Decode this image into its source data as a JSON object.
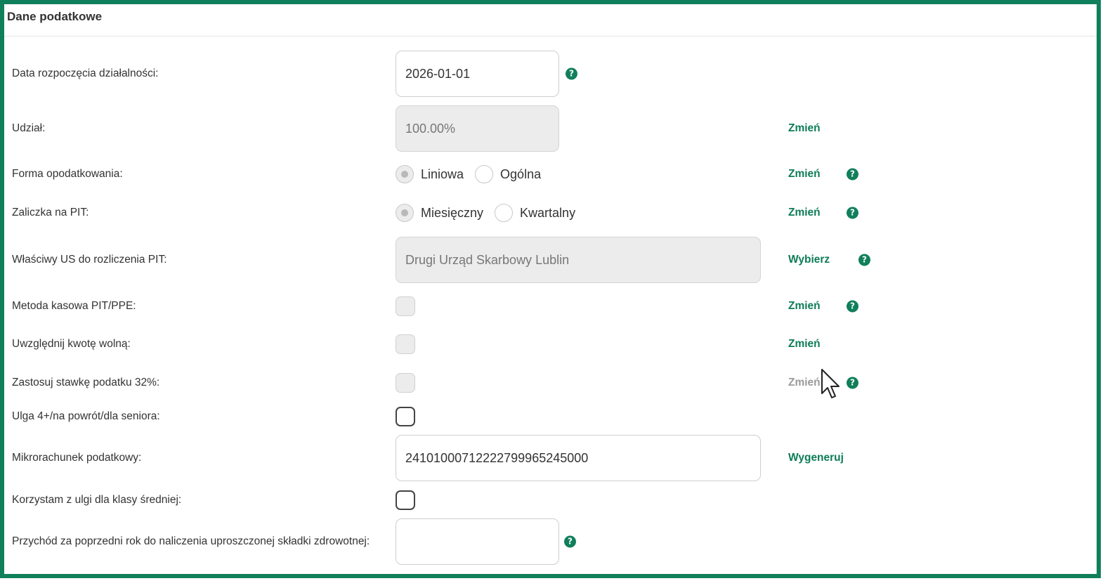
{
  "section": {
    "title": "Dane podatkowe"
  },
  "help_glyph": "?",
  "fields": {
    "data_rozpoczecia": {
      "label": "Data rozpoczęcia działalności:",
      "value": "2026-01-01"
    },
    "udzial": {
      "label": "Udział:",
      "value": "100.00%",
      "action": "Zmień"
    },
    "forma_opodatkowania": {
      "label": "Forma opodatkowania:",
      "options": [
        "Liniowa",
        "Ogólna"
      ],
      "selected": "Liniowa",
      "action": "Zmień"
    },
    "zaliczka_pit": {
      "label": "Zaliczka na PIT:",
      "options": [
        "Miesięczny",
        "Kwartalny"
      ],
      "selected": "Miesięczny",
      "action": "Zmień"
    },
    "wlasciwy_us": {
      "label": "Właściwy US do rozliczenia PIT:",
      "value": "Drugi Urząd Skarbowy Lublin",
      "action": "Wybierz"
    },
    "metoda_kasowa": {
      "label": "Metoda kasowa PIT/PPE:",
      "checked": false,
      "action": "Zmień"
    },
    "kwota_wolna": {
      "label": "Uwzględnij kwotę wolną:",
      "checked": false,
      "action": "Zmień"
    },
    "stawka_32": {
      "label": "Zastosuj stawkę podatku 32%:",
      "checked": false,
      "action": "Zmień"
    },
    "ulga_4plus": {
      "label": "Ulga 4+/na powrót/dla seniora:",
      "checked": false
    },
    "mikrorachunek": {
      "label": "Mikrorachunek podatkowy:",
      "value": "24101000712222799965245000",
      "action": "Wygeneruj"
    },
    "klasa_srednia": {
      "label": "Korzystam z ulgi dla klasy średniej:",
      "checked": false
    },
    "przychod_poprzedni_rok": {
      "label": "Przychód za poprzedni rok do naliczenia uproszczonej składki zdrowotnej:",
      "value": ""
    }
  },
  "colors": {
    "brand": "#107f5b",
    "action": "#0e7c58",
    "muted_action": "#9a9a9a",
    "disabled_bg": "#ececec"
  }
}
